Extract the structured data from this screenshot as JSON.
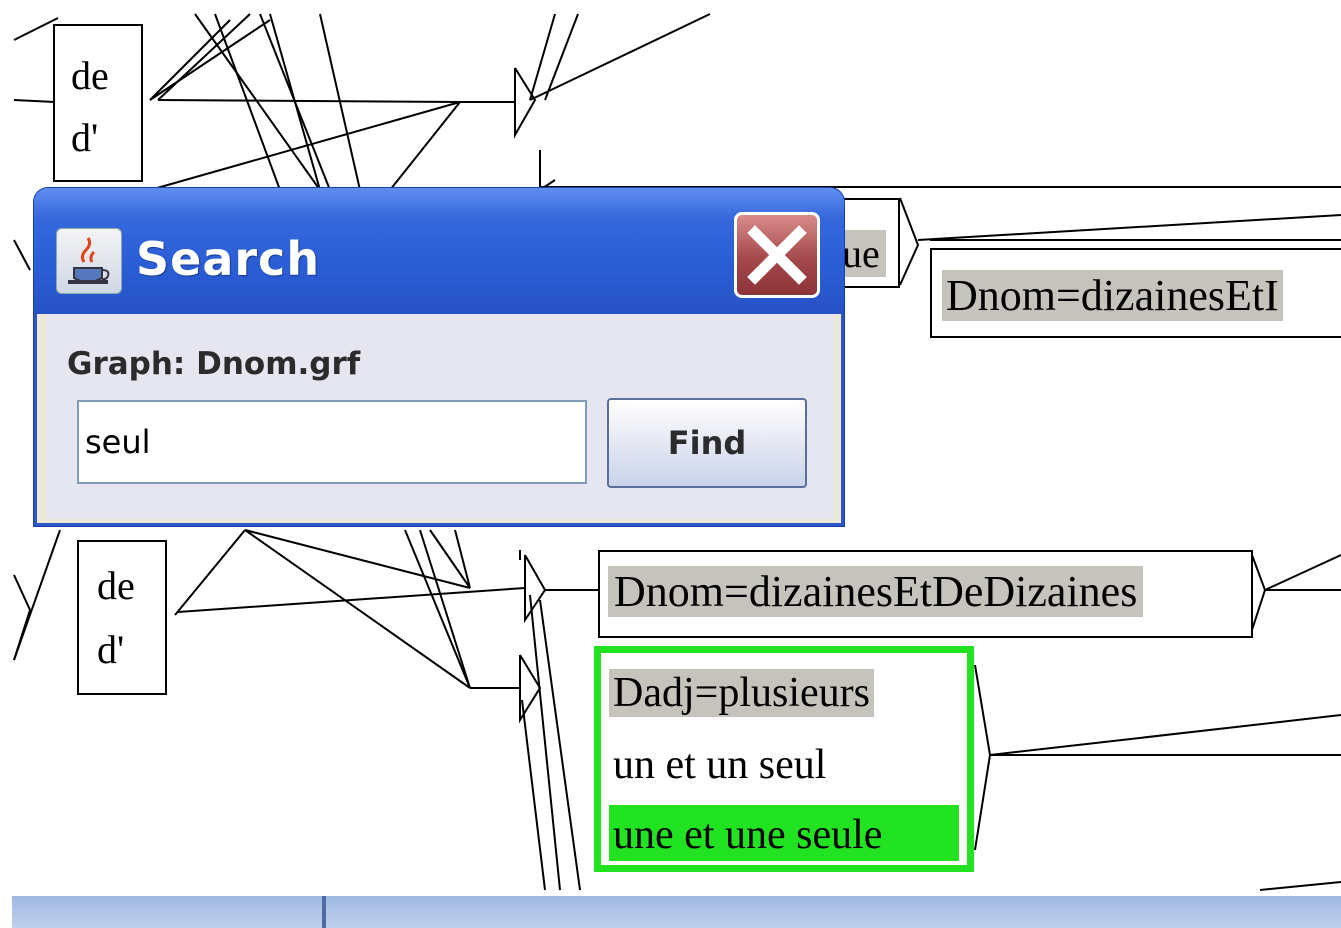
{
  "dialog": {
    "title": "Search",
    "icon": "java-coffee-cup-icon",
    "close_icon": "close-x-icon",
    "graph_label": "Graph: Dnom.grf",
    "search_value": "seul",
    "find_label": "Find"
  },
  "graph": {
    "box_top": {
      "line1": "de",
      "line2": "d'"
    },
    "box_partial": "ue",
    "box_dnom_top": "Dnom=dizainesEtI",
    "box_bottom": {
      "line1": "de",
      "line2": "d'"
    },
    "box_dnom_mid": "Dnom=dizainesEtDeDizaines",
    "selected_box": {
      "line1": "Dadj=plusieurs",
      "line2": "un et un seul",
      "line3": "une et une seule"
    }
  },
  "colors": {
    "highlight_green": "#22e322",
    "grey_label": "#c6c3bd",
    "xp_title_blue": "#2b5ed6"
  }
}
